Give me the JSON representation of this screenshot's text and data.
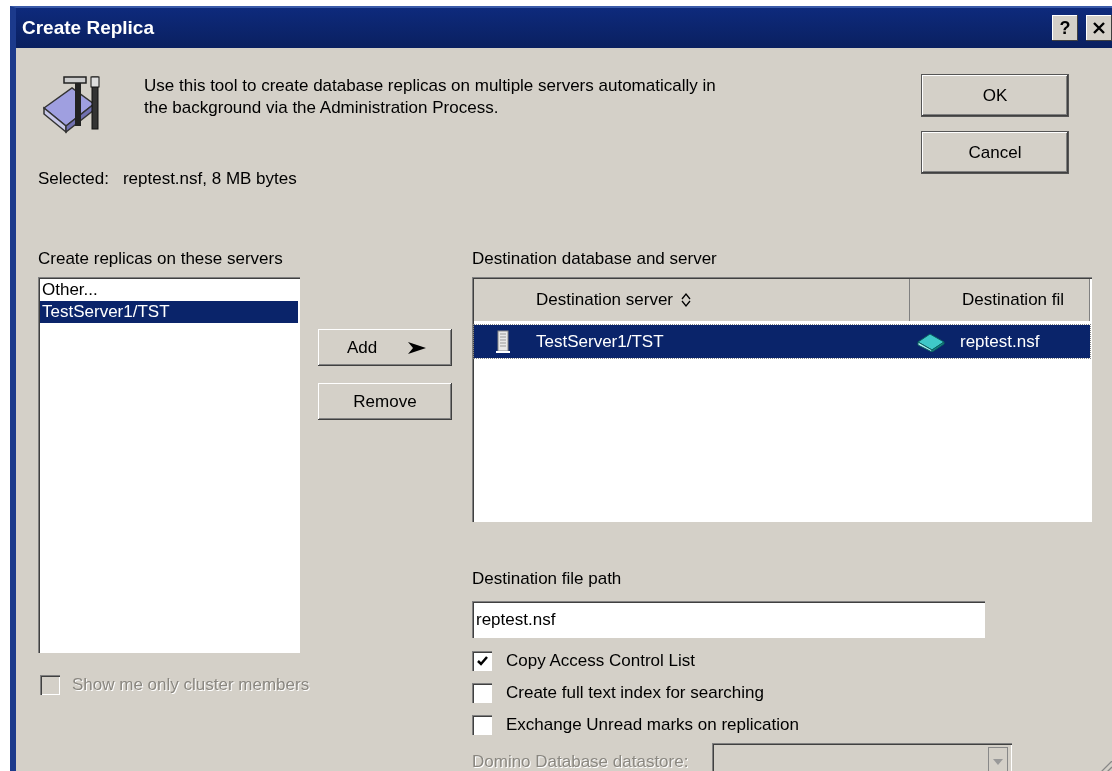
{
  "window": {
    "title": "Create Replica",
    "help_button": "?"
  },
  "description": "Use this tool to create database replicas on multiple servers automatically in the background via the Administration Process.",
  "buttons": [
    {
      "label": "OK"
    },
    {
      "label": "Cancel"
    }
  ],
  "selected_label": "Selected:",
  "selected_value": "reptest.nsf, 8 MB bytes",
  "servers": {
    "label": "Create replicas on these servers",
    "items": [
      {
        "label": "Other...",
        "selected": false
      },
      {
        "label": "TestServer1/TST",
        "selected": true
      }
    ]
  },
  "add_button": "Add",
  "remove_button": "Remove",
  "destination": {
    "label": "Destination database and server",
    "columns": [
      "Destination server",
      "Destination fil"
    ],
    "rows": [
      {
        "server": "TestServer1/TST",
        "file": "reptest.nsf",
        "selected": true
      }
    ]
  },
  "file_path": {
    "label": "Destination file path",
    "value": "reptest.nsf"
  },
  "options": [
    {
      "label": "Copy Access Control List",
      "checked": true,
      "disabled": false
    },
    {
      "label": "Create full text index for searching",
      "checked": false,
      "disabled": false
    },
    {
      "label": "Exchange Unread marks on replication",
      "checked": false,
      "disabled": false
    }
  ],
  "cluster_option": {
    "label": "Show me only cluster members",
    "checked": false,
    "disabled": true
  },
  "datastore": {
    "label": "Domino Database datastore:",
    "disabled": true
  }
}
